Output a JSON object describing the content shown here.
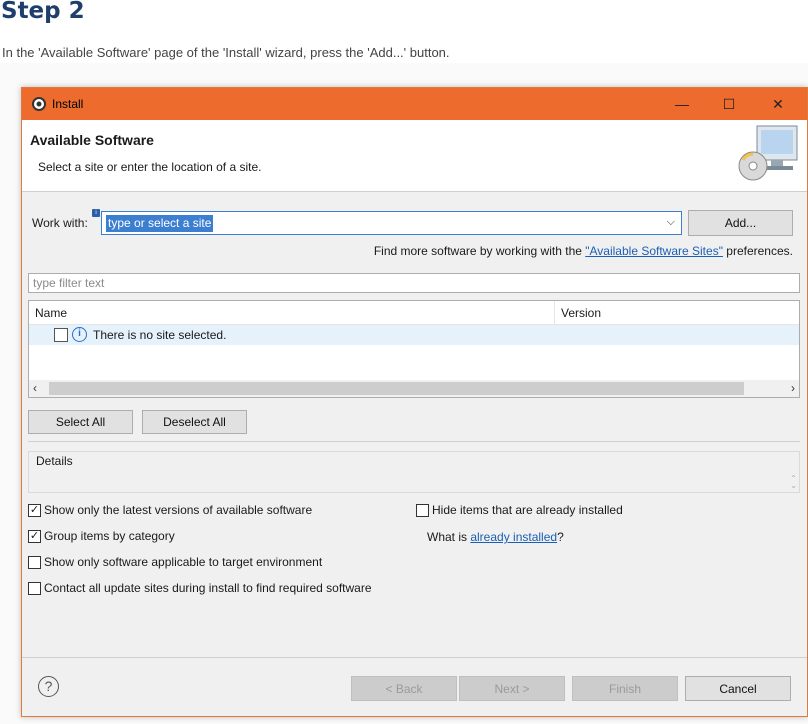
{
  "step": {
    "title": "Step 2",
    "description": "In the 'Available Software' page of the 'Install' wizard, press the 'Add...' button."
  },
  "window": {
    "title": "Install",
    "min_glyph": "—",
    "max_glyph": "☐",
    "close_glyph": "✕",
    "accent_color": "#ec6b2d"
  },
  "header": {
    "title": "Available Software",
    "description": "Select a site or enter the location of a site."
  },
  "work_with": {
    "label": "Work with:",
    "value": "type or select a site",
    "add_button": "Add..."
  },
  "find_more": {
    "prefix": "Find more software by working with the ",
    "link": "\"Available Software Sites\"",
    "suffix": " preferences."
  },
  "filter": {
    "placeholder": "type filter text"
  },
  "table": {
    "columns": [
      "Name",
      "Version"
    ],
    "rows": [
      {
        "name": "There is no site selected.",
        "version": "",
        "checked": false
      }
    ]
  },
  "buttons": {
    "select_all": "Select All",
    "deselect_all": "Deselect All",
    "back": "< Back",
    "next": "Next >",
    "finish": "Finish",
    "cancel": "Cancel"
  },
  "details": {
    "label": "Details"
  },
  "options": {
    "latest": {
      "label": "Show only the latest versions of available software",
      "checked": true
    },
    "group": {
      "label": "Group items by category",
      "checked": true
    },
    "target": {
      "label": "Show only software applicable to target environment",
      "checked": false
    },
    "contact": {
      "label": "Contact all update sites during install to find required software",
      "checked": false
    },
    "hide": {
      "label": "Hide items that are already installed",
      "checked": false
    }
  },
  "what_is": {
    "prefix": "What is ",
    "link": "already installed",
    "suffix": "?"
  },
  "icons": {
    "app": "eclipse-gear-icon",
    "header": "software-install-cd-monitor-icon",
    "info": "info-icon",
    "help": "help-icon"
  }
}
